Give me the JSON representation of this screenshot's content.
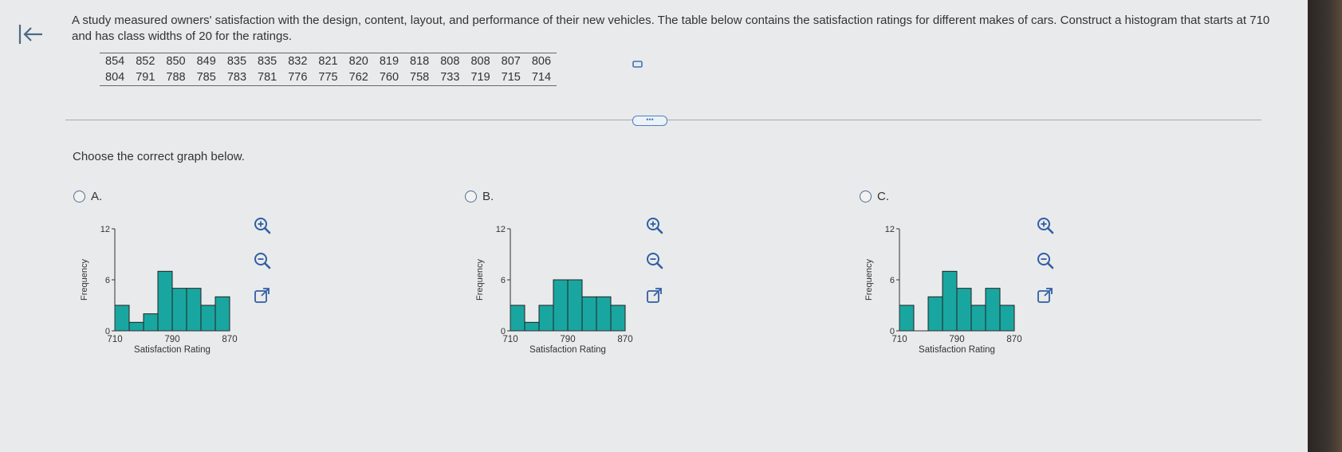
{
  "prompt": "A study measured owners' satisfaction with the design, content, layout, and performance of their new vehicles. The table below contains the satisfaction ratings for different makes of cars. Construct a histogram that starts at 710 and has class widths of 20 for the ratings.",
  "table": {
    "rows": [
      [
        "854",
        "852",
        "850",
        "849",
        "835",
        "835",
        "832",
        "821",
        "820",
        "819",
        "818",
        "808",
        "808",
        "807",
        "806"
      ],
      [
        "804",
        "791",
        "788",
        "785",
        "783",
        "781",
        "776",
        "775",
        "762",
        "760",
        "758",
        "733",
        "719",
        "715",
        "714"
      ]
    ]
  },
  "more_label": "•••",
  "instruction": "Choose the correct graph below.",
  "options": [
    {
      "label": "A."
    },
    {
      "label": "B."
    },
    {
      "label": "C."
    }
  ],
  "icons": {
    "back": "back-to-start-icon",
    "copy": "copy-data-icon",
    "zoom_in": "zoom-in-icon",
    "zoom_out": "zoom-out-icon",
    "open": "open-new-window-icon"
  },
  "colors": {
    "bar_fill": "#19a6a0",
    "bar_stroke": "#222222",
    "link": "#2f5fa3"
  },
  "chart_data": [
    {
      "type": "bar",
      "ylabel": "Frequency",
      "xlabel": "Satisfaction Rating",
      "x_ticks": [
        "710",
        "790",
        "870"
      ],
      "y_ticks": [
        "0",
        "6",
        "12"
      ],
      "bin_edges": [
        710,
        730,
        750,
        770,
        790,
        810,
        830,
        850,
        870
      ],
      "values": [
        3,
        1,
        2,
        7,
        5,
        5,
        3,
        4
      ],
      "ylim": [
        0,
        12
      ]
    },
    {
      "type": "bar",
      "ylabel": "Frequency",
      "xlabel": "Satisfaction Rating",
      "x_ticks": [
        "710",
        "790",
        "870"
      ],
      "y_ticks": [
        "0",
        "6",
        "12"
      ],
      "bin_edges": [
        710,
        730,
        750,
        770,
        790,
        810,
        830,
        850,
        870
      ],
      "values": [
        3,
        1,
        3,
        6,
        6,
        4,
        4,
        3
      ],
      "ylim": [
        0,
        12
      ]
    },
    {
      "type": "bar",
      "ylabel": "Frequency",
      "xlabel": "Satisfaction Rating",
      "x_ticks": [
        "710",
        "790",
        "870"
      ],
      "y_ticks": [
        "0",
        "6",
        "12"
      ],
      "bin_edges": [
        710,
        730,
        750,
        770,
        790,
        810,
        830,
        850,
        870
      ],
      "values": [
        3,
        0,
        4,
        7,
        5,
        3,
        5,
        3
      ],
      "ylim": [
        0,
        12
      ]
    }
  ]
}
